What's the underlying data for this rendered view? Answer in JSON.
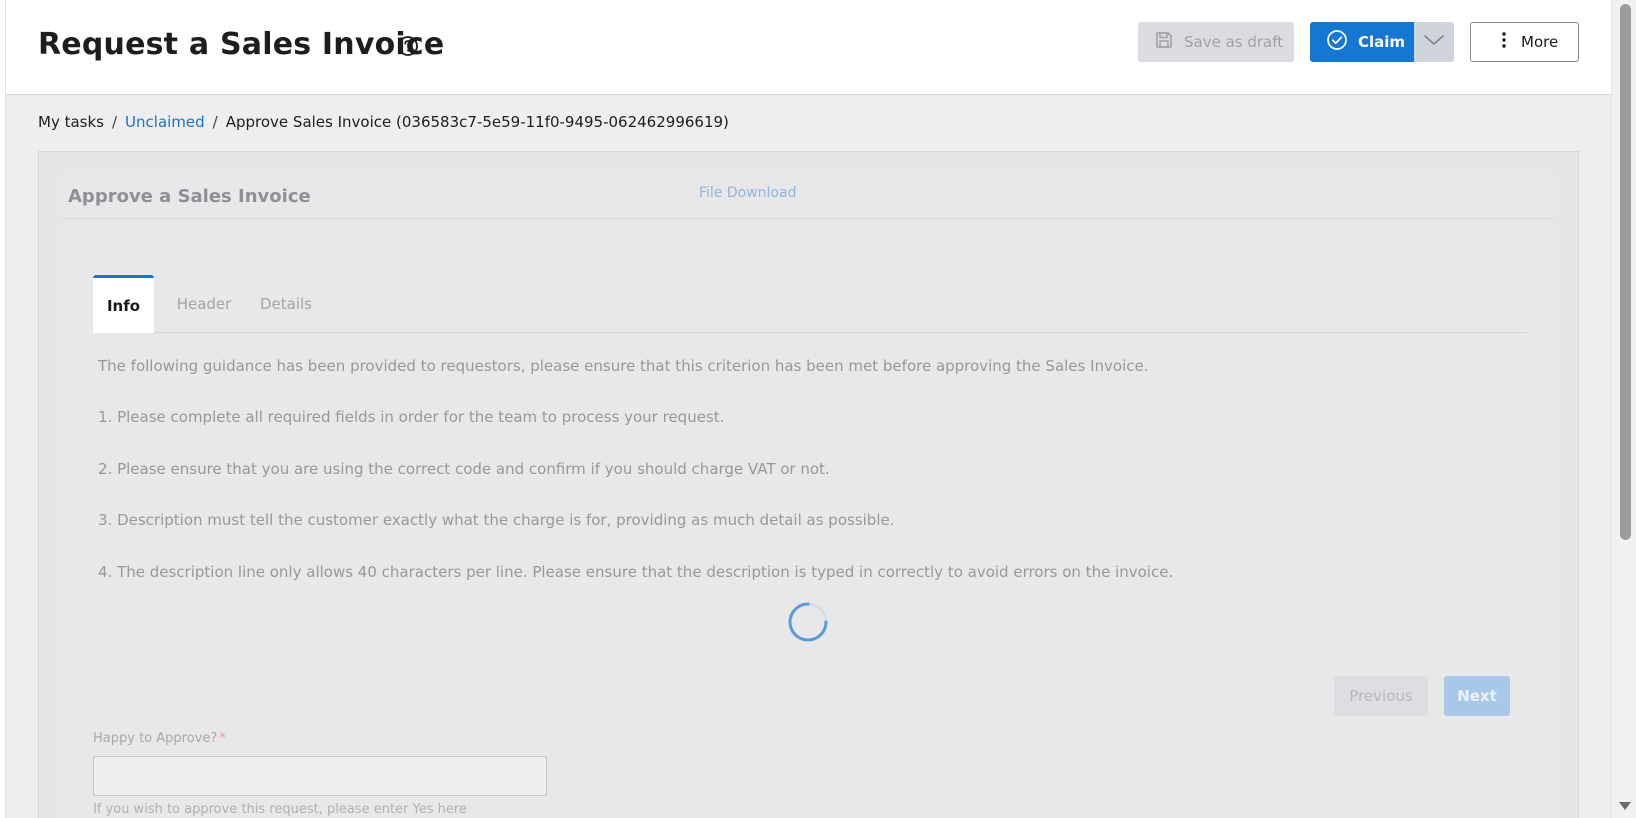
{
  "header": {
    "title": "Request a Sales Invoice",
    "save_draft_label": "Save as draft",
    "claim_label": "Claim",
    "more_label": "More"
  },
  "breadcrumb": {
    "items": [
      "My tasks",
      "Unclaimed",
      "Approve Sales Invoice (036583c7-5e59-11f0-9495-062462996619)"
    ],
    "separator": "/"
  },
  "form": {
    "title": "Approve a Sales Invoice",
    "file_download": "File Download",
    "tabs": [
      "Info",
      "Header",
      "Details"
    ],
    "active_tab": "Info",
    "guidance": [
      "The following guidance has been provided to requestors, please ensure that this criterion has been met before approving the Sales Invoice.",
      "1. Please complete all required fields in order for the team to process your request.",
      "2. Please ensure that you are using the correct code and confirm if you should charge VAT or not.",
      "3. Description must tell the customer exactly what the charge is for, providing as much detail as possible.",
      "4. The description line only allows 40 characters per line. Please ensure that the description is typed in correctly to avoid errors on the invoice."
    ],
    "previous_label": "Previous",
    "next_label": "Next",
    "approve_field": {
      "label": "Happy to Approve?",
      "required_marker": "*",
      "value": "",
      "help": "If you wish to approve this request, please enter Yes here"
    }
  },
  "colors": {
    "primary": "#1677d2",
    "link": "#1a73c8",
    "disabled_button": "#dcdce0",
    "overlay_bg": "#e6e6e8"
  },
  "icons": [
    "help-circle-icon",
    "save-icon",
    "check-circle-icon",
    "chevron-down-icon",
    "more-vertical-icon",
    "loading-spinner-icon"
  ]
}
